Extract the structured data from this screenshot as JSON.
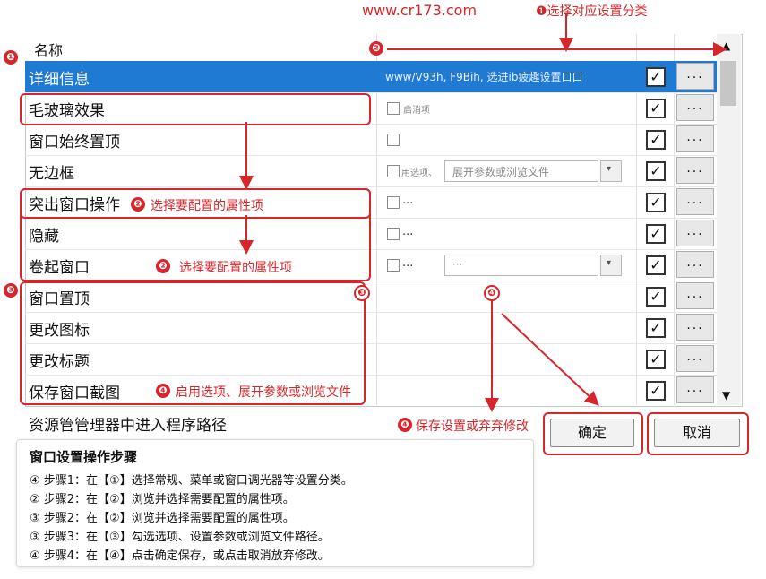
{
  "watermark": "www.cr173.com",
  "callouts": {
    "top_right": "❶选择对应设置分类",
    "left_1": "❶",
    "top_2": "❷",
    "left_3": "❸",
    "mid_3": "❸",
    "mid_4": "❹",
    "select_attr_1": "选择要配置的属性项",
    "select_attr_2": "选择要配置的属性项",
    "enable_options": "启用选项、展开参数或浏览文件",
    "save_or_discard": "保存设置或弃弃修改",
    "badge_2a": "❷",
    "badge_2b": "❷",
    "badge_4a": "❹",
    "badge_4b": "❹"
  },
  "list": {
    "header": "名称",
    "rows": [
      {
        "name": "详细信息",
        "opt_text": "www/V93h, F9Bih, 选进ib疲趣设置口口",
        "checked": true
      },
      {
        "name": "毛玻璃效果",
        "opt_label": "启消项",
        "checked": true
      },
      {
        "name": "窗口始终置顶",
        "checked": true
      },
      {
        "name": "无边框",
        "opt_label": "用选项、",
        "combo": "展开参数或浏览文件",
        "checked": true
      },
      {
        "name": "突出窗口操作",
        "opt_dots": "...",
        "checked": true
      },
      {
        "name": "隐藏",
        "opt_dots": "...",
        "checked": true
      },
      {
        "name": "卷起窗口",
        "opt_dots": "...",
        "combo": "···",
        "checked": true
      },
      {
        "name": "窗口置顶",
        "checked": true
      },
      {
        "name": "更改图标",
        "checked": true
      },
      {
        "name": "更改标题",
        "checked": true
      },
      {
        "name": "保存窗口截图",
        "checked": true
      }
    ],
    "dots_label": "...",
    "check_mark": "✓",
    "footer_row": "资源管管理器中进入程序路径"
  },
  "buttons": {
    "ok": "确定",
    "cancel": "取消"
  },
  "steps": {
    "title": "窗口设置操作步骤",
    "lines": [
      "④ 步骤1：在【①】选择常规、菜单或窗口调光器等设置分类。",
      "② 步骤2：在【②】浏览并选择需要配置的属性项。",
      "③ 步骤2：在【②】浏览并选择需要配置的属性项。",
      "③ 步骤3：在【③】勾选选项、设置参数或浏览文件路径。",
      "④ 步骤4：在【④】点击确定保存，或点击取消放弃修改。"
    ]
  },
  "colors": {
    "accent": "#d7262b",
    "selection": "#1f7ad3"
  }
}
